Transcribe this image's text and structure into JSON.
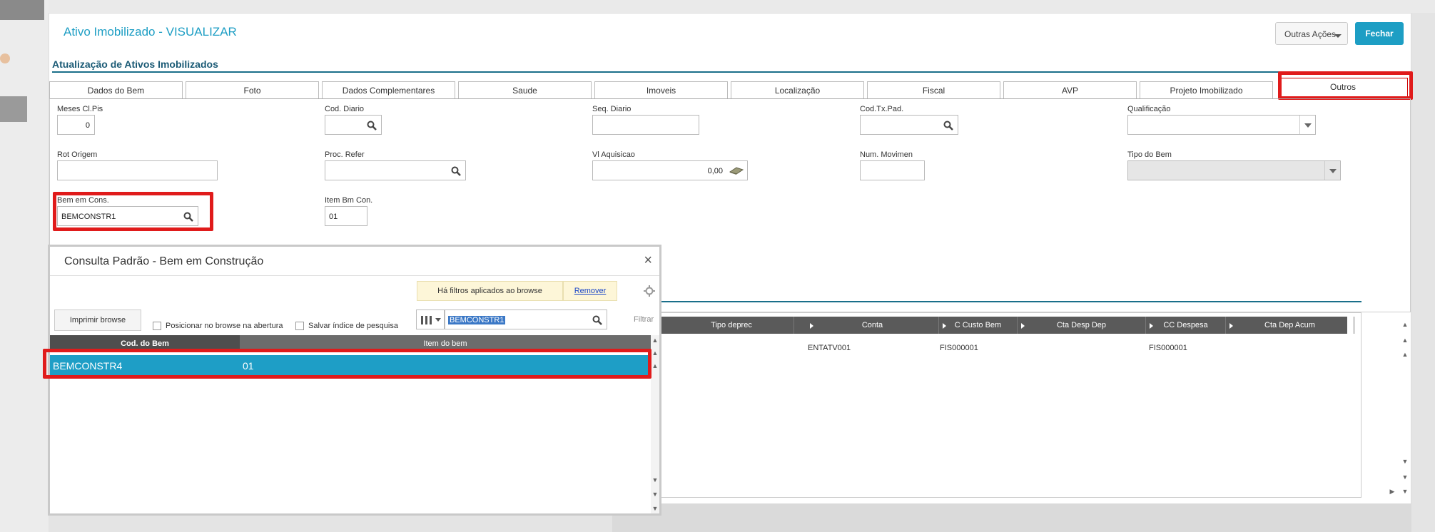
{
  "header": {
    "title": "Ativo Imobilizado - VISUALIZAR",
    "outras_acoes": "Outras Ações",
    "fechar": "Fechar"
  },
  "section_title": "Atualização de Ativos Imobilizados",
  "tabs": [
    {
      "label": "Dados do Bem"
    },
    {
      "label": "Foto"
    },
    {
      "label": "Dados Complementares"
    },
    {
      "label": "Saude"
    },
    {
      "label": "Imoveis"
    },
    {
      "label": "Localização"
    },
    {
      "label": "Fiscal"
    },
    {
      "label": "AVP"
    },
    {
      "label": "Projeto Imobilizado"
    },
    {
      "label": "Outros"
    }
  ],
  "fields": {
    "meses_cl_pis": {
      "label": "Meses Cl.Pis",
      "value": "0"
    },
    "cod_diario": {
      "label": "Cod. Diario",
      "value": ""
    },
    "seq_diario": {
      "label": "Seq. Diario",
      "value": ""
    },
    "cod_tx_pad": {
      "label": "Cod.Tx.Pad.",
      "value": ""
    },
    "qualificacao": {
      "label": "Qualificação",
      "value": ""
    },
    "rot_origem": {
      "label": "Rot Origem",
      "value": ""
    },
    "proc_refer": {
      "label": "Proc. Refer",
      "value": ""
    },
    "vl_aquisicao": {
      "label": "Vl Aquisicao",
      "value": "0,00"
    },
    "num_movimen": {
      "label": "Num. Movimen",
      "value": ""
    },
    "tipo_do_bem": {
      "label": "Tipo do Bem",
      "value": ""
    },
    "bem_em_cons": {
      "label": "Bem em Cons.",
      "value": "BEMCONSTR1"
    },
    "item_bm_con": {
      "label": "Item Bm Con.",
      "value": "01"
    }
  },
  "grid": {
    "columns": [
      "Tipo deprec",
      "Conta",
      "C Custo Bem",
      "Cta Desp Dep",
      "CC Despesa",
      "Cta Dep Acum"
    ],
    "row": {
      "conta": "ENTATV001",
      "c_custo_bem": "FIS000001",
      "cc_despesa": "FIS000001"
    }
  },
  "modal": {
    "title": "Consulta Padrão - Bem em Construção",
    "filter_notice": "Há filtros aplicados ao browse",
    "remover": "Remover",
    "imprimir": "Imprimir browse",
    "posicionar": "Posicionar no browse na abertura",
    "salvar_indice": "Salvar índice de pesquisa",
    "search_value": "BEMCONSTR1",
    "filtrar": "Filtrar",
    "columns": [
      "Cod. do Bem",
      "Item do bem"
    ],
    "rows": [
      {
        "cod": "BEMCONSTR4",
        "item": "01"
      }
    ]
  },
  "colors": {
    "accent": "#1d9ec4",
    "highlight_box": "#e01b1b",
    "selected_row": "#1e9ec6"
  }
}
